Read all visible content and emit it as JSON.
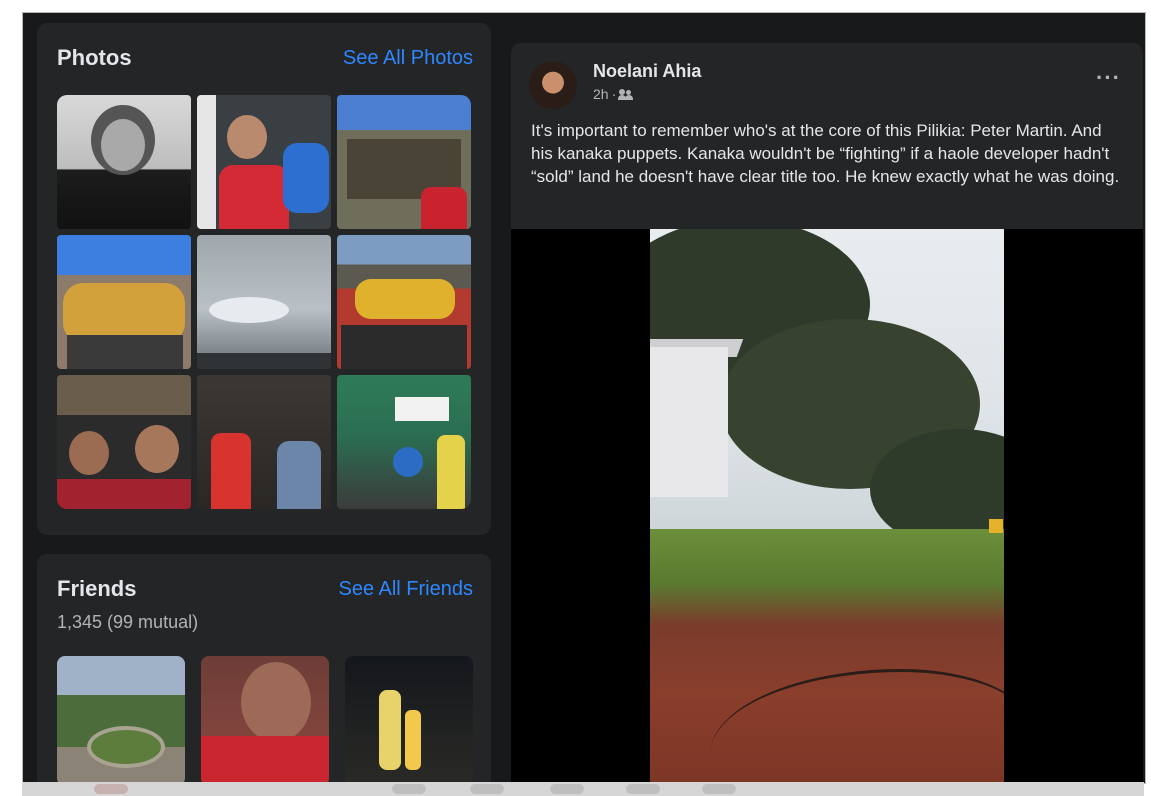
{
  "photos": {
    "title": "Photos",
    "see_all": "See All Photos",
    "items": [
      {
        "icon": "photo-portrait-bw"
      },
      {
        "icon": "photo-car-selfie"
      },
      {
        "icon": "photo-crowd-outdoors"
      },
      {
        "icon": "photo-crowd-flag"
      },
      {
        "icon": "photo-clouds"
      },
      {
        "icon": "photo-crowd-mountain"
      },
      {
        "icon": "photo-group-selfie"
      },
      {
        "icon": "photo-people-indoors"
      },
      {
        "icon": "photo-group-banner"
      }
    ]
  },
  "friends": {
    "title": "Friends",
    "see_all": "See All Friends",
    "count": "1,345 (99 mutual)",
    "items": [
      {
        "icon": "friend-photo-1"
      },
      {
        "icon": "friend-photo-2"
      },
      {
        "icon": "friend-photo-3"
      }
    ]
  },
  "post": {
    "author": "Noelani Ahia",
    "time": "2h",
    "separator": "·",
    "audience_icon": "friends-icon",
    "text": "It's important to remember who's at the core of this Pilikia: Peter Martin. And his kanaka puppets. Kanaka wouldn't be “fighting” if a haole developer hadn't “sold” land he doesn't have clear title too. He knew exactly what he was doing.",
    "more_label": "···"
  },
  "colors": {
    "background": "#18191a",
    "card": "#242526",
    "text_primary": "#e4e6eb",
    "text_secondary": "#b0b3b8",
    "link": "#2d88ff"
  }
}
